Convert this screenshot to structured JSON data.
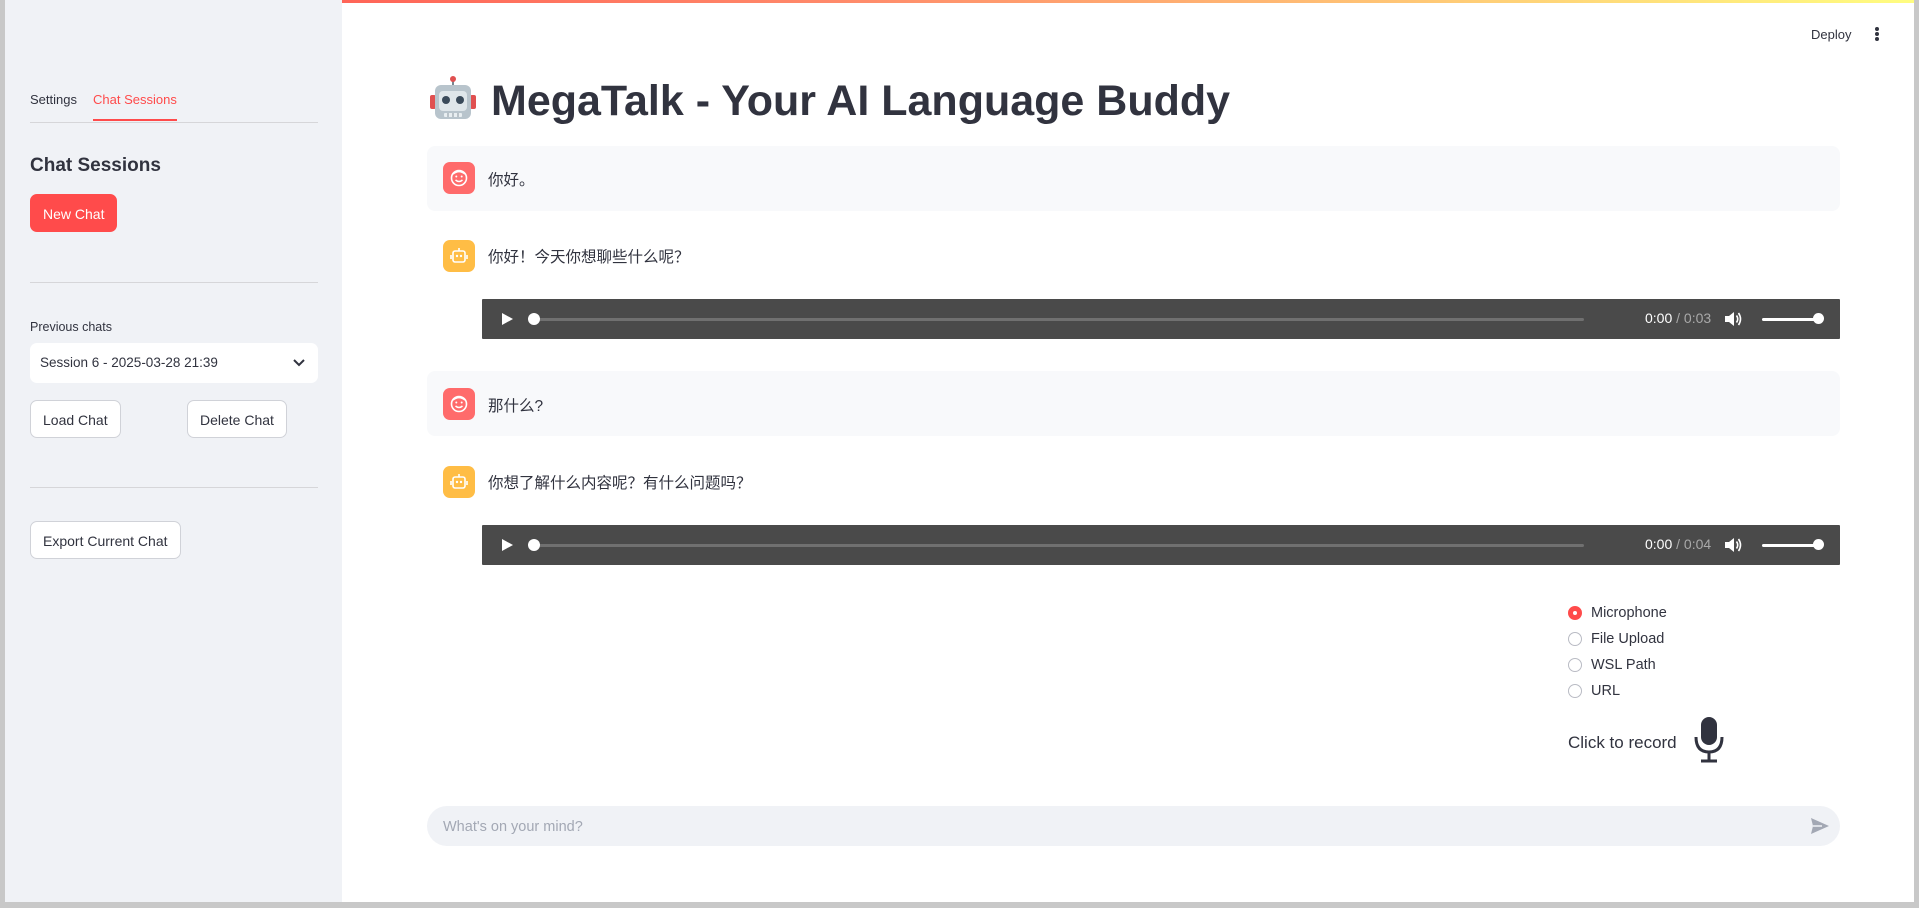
{
  "sidebar": {
    "tabs": [
      {
        "label": "Settings"
      },
      {
        "label": "Chat Sessions"
      }
    ],
    "title": "Chat Sessions",
    "new_chat_label": "New Chat",
    "previous_chats_label": "Previous chats",
    "selected_session": "Session 6 - 2025-03-28 21:39",
    "load_chat_label": "Load Chat",
    "delete_chat_label": "Delete Chat",
    "export_label": "Export Current Chat"
  },
  "header": {
    "deploy_label": "Deploy"
  },
  "main": {
    "title": "MegaTalk - Your AI Language Buddy",
    "messages": [
      {
        "role": "user",
        "text": "你好。"
      },
      {
        "role": "assistant",
        "text": "你好！今天你想聊些什么呢？",
        "audio": {
          "current": "0:00",
          "duration": "/ 0:03"
        }
      },
      {
        "role": "user",
        "text": "那什么?"
      },
      {
        "role": "assistant",
        "text": "你想了解什么内容呢？有什么问题吗？",
        "audio": {
          "current": "0:00",
          "duration": "/ 0:04"
        }
      }
    ],
    "input_options": [
      {
        "label": "Microphone",
        "selected": true
      },
      {
        "label": "File Upload",
        "selected": false
      },
      {
        "label": "WSL Path",
        "selected": false
      },
      {
        "label": "URL",
        "selected": false
      }
    ],
    "record_label": "Click to record",
    "chat_placeholder": "What's on your mind?"
  },
  "colors": {
    "accent": "#ff4b4b",
    "user_avatar": "#ff6b6b",
    "bot_avatar": "#ffbd45",
    "sidebar_bg": "#f0f2f6",
    "audio_bg": "#4a4a4a"
  },
  "icons": {
    "title_icon": "robot-emoji-icon",
    "user_avatar": "user-face-icon",
    "bot_avatar": "bot-face-icon",
    "play": "play-icon",
    "volume": "volume-icon",
    "record": "microphone-icon",
    "send": "send-icon",
    "menu": "kebab-menu-icon",
    "select": "chevron-down-icon"
  }
}
